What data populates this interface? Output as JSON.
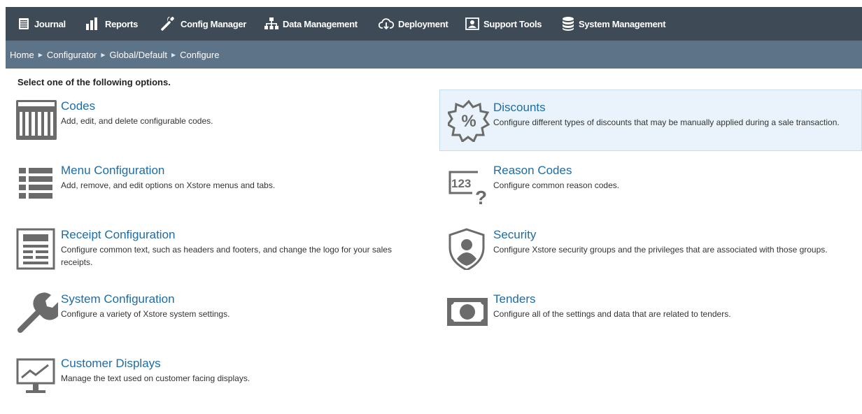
{
  "nav": {
    "items": [
      {
        "label": "Journal"
      },
      {
        "label": "Reports"
      },
      {
        "label": "Config Manager"
      },
      {
        "label": "Data Management"
      },
      {
        "label": "Deployment"
      },
      {
        "label": "Support Tools"
      },
      {
        "label": "System Management"
      }
    ]
  },
  "breadcrumb": [
    "Home",
    "Configurator",
    "Global/Default",
    "Configure"
  ],
  "page": {
    "instructions": "Select one of the following options."
  },
  "options": [
    {
      "title": "Codes",
      "description": "Add, edit, and delete configurable codes.",
      "icon": "barcode-icon"
    },
    {
      "title": "Discounts",
      "description": "Configure different types of discounts that may be manually applied during a sale transaction.",
      "icon": "percent-badge-icon",
      "highlighted": true
    },
    {
      "title": "Menu Configuration",
      "description": "Add, remove, and edit options on Xstore menus and tabs.",
      "icon": "menu-list-icon"
    },
    {
      "title": "Reason Codes",
      "description": "Configure common reason codes.",
      "icon": "reason-code-icon",
      "icon_text": "123"
    },
    {
      "title": "Receipt Configuration",
      "description": "Configure common text, such as headers and footers, and change the logo for your sales receipts.",
      "icon": "receipt-icon"
    },
    {
      "title": "Security",
      "description": "Configure Xstore security groups and the privileges that are associated with those groups.",
      "icon": "shield-user-icon"
    },
    {
      "title": "System Configuration",
      "description": "Configure a variety of Xstore system settings.",
      "icon": "wrench-icon"
    },
    {
      "title": "Tenders",
      "description": "Configure all of the settings and data that are related to tenders.",
      "icon": "banknote-icon"
    },
    {
      "title": "Customer Displays",
      "description": "Manage the text used on customer facing displays.",
      "icon": "monitor-icon"
    }
  ],
  "colors": {
    "topbar": "#3e4a56",
    "breadcrumb_bar": "#5d7388",
    "link": "#1e6ba5",
    "icon": "#6b6b6b",
    "highlight": "#eaf3fb"
  }
}
